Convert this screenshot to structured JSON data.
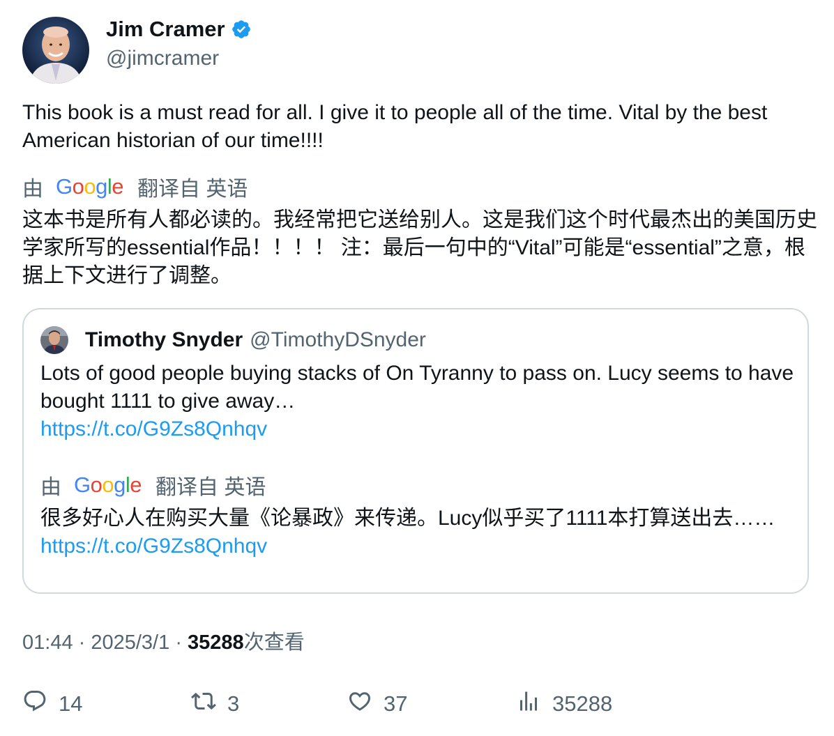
{
  "author": {
    "name": "Jim Cramer",
    "handle": "@jimcramer",
    "verified": true
  },
  "tweet": {
    "text": "This book is a must read for all. I give it to people all of the time. Vital by the best American historian of our time!!!!",
    "translation_by": "由",
    "translation_from": "翻译自 英语",
    "translated_text": "这本书是所有人都必读的。我经常把它送给别人。这是我们这个时代最杰出的美国历史学家所写的essential作品！！！！ 注：最后一句中的“Vital”可能是“essential”之意，根据上下文进行了调整。"
  },
  "quote": {
    "name": "Timothy Snyder",
    "handle": "@TimothyDSnyder",
    "text": "Lots of good people buying stacks of On Tyranny to pass on. Lucy seems to have bought 1111 to give away…",
    "link": "https://t.co/G9Zs8Qnhqv",
    "translation_by": "由",
    "translation_from": "翻译自 英语",
    "translated_text": "很多好心人在购买大量《论暴政》来传递。Lucy似乎买了1111本打算送出去……",
    "translated_link": "https://t.co/G9Zs8Qnhqv"
  },
  "meta": {
    "time": "01:44",
    "date": "2025/3/1",
    "views": "35288",
    "views_label": "次查看"
  },
  "actions": {
    "replies": "14",
    "retweets": "3",
    "likes": "37",
    "views": "35288"
  },
  "google_logo": "Google",
  "colors": {
    "link": "#1d9bf0",
    "verified": "#1d9bf0",
    "muted": "#536471",
    "text": "#0f1419"
  }
}
